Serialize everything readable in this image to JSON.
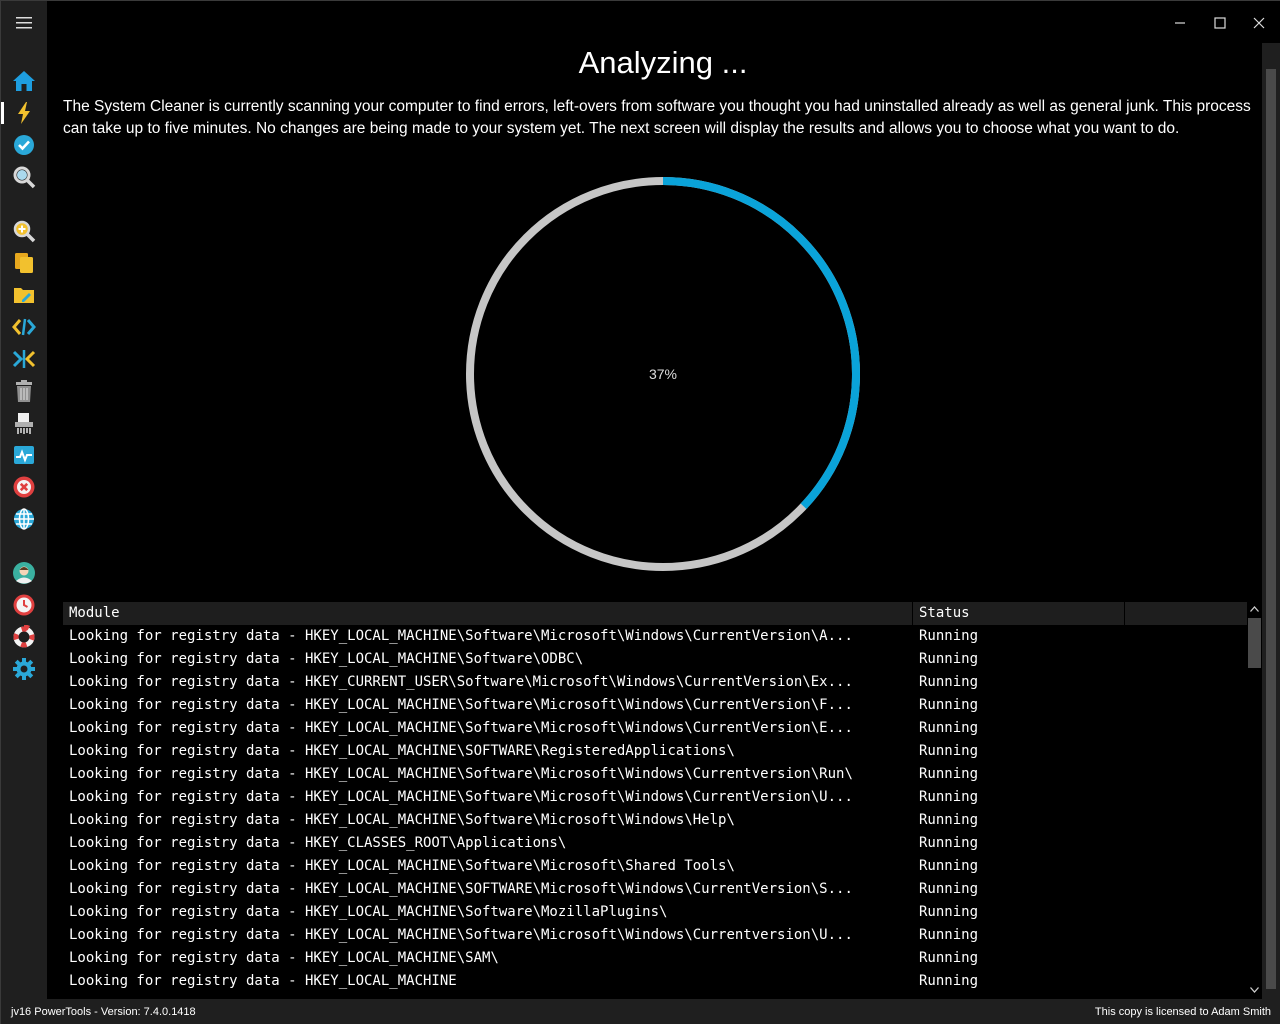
{
  "window": {
    "title_heading": "Analyzing ...",
    "controls": [
      "minimize-icon",
      "maximize-icon",
      "close-icon"
    ]
  },
  "sidebar": {
    "menu_icon": "hamburger-menu-icon",
    "items": [
      {
        "icon": "home-icon",
        "color": "#1e9ee0",
        "active": false
      },
      {
        "icon": "lightning-icon",
        "color": "#f2c12e",
        "active": true
      },
      {
        "icon": "checkmark-icon",
        "color": "#2aa8d8",
        "active": false
      },
      {
        "icon": "magnifier-icon",
        "color": "#d8d8d8",
        "active": false
      },
      {
        "icon": "search-plus-icon",
        "color": "#f2c12e",
        "active": false
      },
      {
        "icon": "copy-files-icon",
        "color": "#f2c12e",
        "active": false
      },
      {
        "icon": "folder-edit-icon",
        "color": "#f2c12e",
        "active": false
      },
      {
        "icon": "code-brackets-icon",
        "color": "#2aa8d8",
        "active": false
      },
      {
        "icon": "merge-arrows-icon",
        "color": "#2aa8d8",
        "active": false
      },
      {
        "icon": "trash-icon",
        "color": "#b0b0b0",
        "active": false
      },
      {
        "icon": "shredder-icon",
        "color": "#d8d8d8",
        "active": false
      },
      {
        "icon": "monitor-pulse-icon",
        "color": "#2aa8d8",
        "active": false
      },
      {
        "icon": "error-x-icon",
        "color": "#e04040",
        "active": false
      },
      {
        "icon": "globe-icon",
        "color": "#2aa8d8",
        "active": false
      },
      {
        "icon": "user-avatar-icon",
        "color": "#3ab0a0",
        "active": false
      },
      {
        "icon": "clock-icon",
        "color": "#e04040",
        "active": false
      },
      {
        "icon": "lifebuoy-icon",
        "color": "#e04040",
        "active": false
      },
      {
        "icon": "gear-icon",
        "color": "#2aa8d8",
        "active": false
      }
    ]
  },
  "main": {
    "heading": "Analyzing ...",
    "description": "The System Cleaner is currently scanning your computer to find errors, left-overs from software you thought you had uninstalled already as well as general junk. This process can take up to five minutes. No changes are being made to your system yet. The next screen will display the results and allows you to choose what you want to do.",
    "progress": {
      "value": 0.37,
      "label": "37%",
      "fill_color": "#0aa3d9",
      "track_color": "#c6c6c6"
    }
  },
  "table": {
    "columns": [
      "Module",
      "Status"
    ],
    "rows": [
      {
        "module": "Looking for registry data - HKEY_LOCAL_MACHINE\\Software\\Microsoft\\Windows\\CurrentVersion\\A...",
        "status": "Running"
      },
      {
        "module": "Looking for registry data - HKEY_LOCAL_MACHINE\\Software\\ODBC\\",
        "status": "Running"
      },
      {
        "module": "Looking for registry data - HKEY_CURRENT_USER\\Software\\Microsoft\\Windows\\CurrentVersion\\Ex...",
        "status": "Running"
      },
      {
        "module": "Looking for registry data - HKEY_LOCAL_MACHINE\\Software\\Microsoft\\Windows\\CurrentVersion\\F...",
        "status": "Running"
      },
      {
        "module": "Looking for registry data - HKEY_LOCAL_MACHINE\\Software\\Microsoft\\Windows\\CurrentVersion\\E...",
        "status": "Running"
      },
      {
        "module": "Looking for registry data - HKEY_LOCAL_MACHINE\\SOFTWARE\\RegisteredApplications\\",
        "status": "Running"
      },
      {
        "module": "Looking for registry data - HKEY_LOCAL_MACHINE\\Software\\Microsoft\\Windows\\Currentversion\\Run\\",
        "status": "Running"
      },
      {
        "module": "Looking for registry data - HKEY_LOCAL_MACHINE\\Software\\Microsoft\\Windows\\CurrentVersion\\U...",
        "status": "Running"
      },
      {
        "module": "Looking for registry data - HKEY_LOCAL_MACHINE\\Software\\Microsoft\\Windows\\Help\\",
        "status": "Running"
      },
      {
        "module": "Looking for registry data - HKEY_CLASSES_ROOT\\Applications\\",
        "status": "Running"
      },
      {
        "module": "Looking for registry data - HKEY_LOCAL_MACHINE\\Software\\Microsoft\\Shared Tools\\",
        "status": "Running"
      },
      {
        "module": "Looking for registry data - HKEY_LOCAL_MACHINE\\SOFTWARE\\Microsoft\\Windows\\CurrentVersion\\S...",
        "status": "Running"
      },
      {
        "module": "Looking for registry data - HKEY_LOCAL_MACHINE\\Software\\MozillaPlugins\\",
        "status": "Running"
      },
      {
        "module": "Looking for registry data - HKEY_LOCAL_MACHINE\\Software\\Microsoft\\Windows\\Currentversion\\U...",
        "status": "Running"
      },
      {
        "module": "Looking for registry data - HKEY_LOCAL_MACHINE\\SAM\\",
        "status": "Running"
      },
      {
        "module": "Looking for registry data - HKEY_LOCAL_MACHINE",
        "status": "Running"
      }
    ]
  },
  "statusbar": {
    "version": "jv16 PowerTools - Version: 7.4.0.1418",
    "license": "This copy is licensed to Adam Smith"
  }
}
